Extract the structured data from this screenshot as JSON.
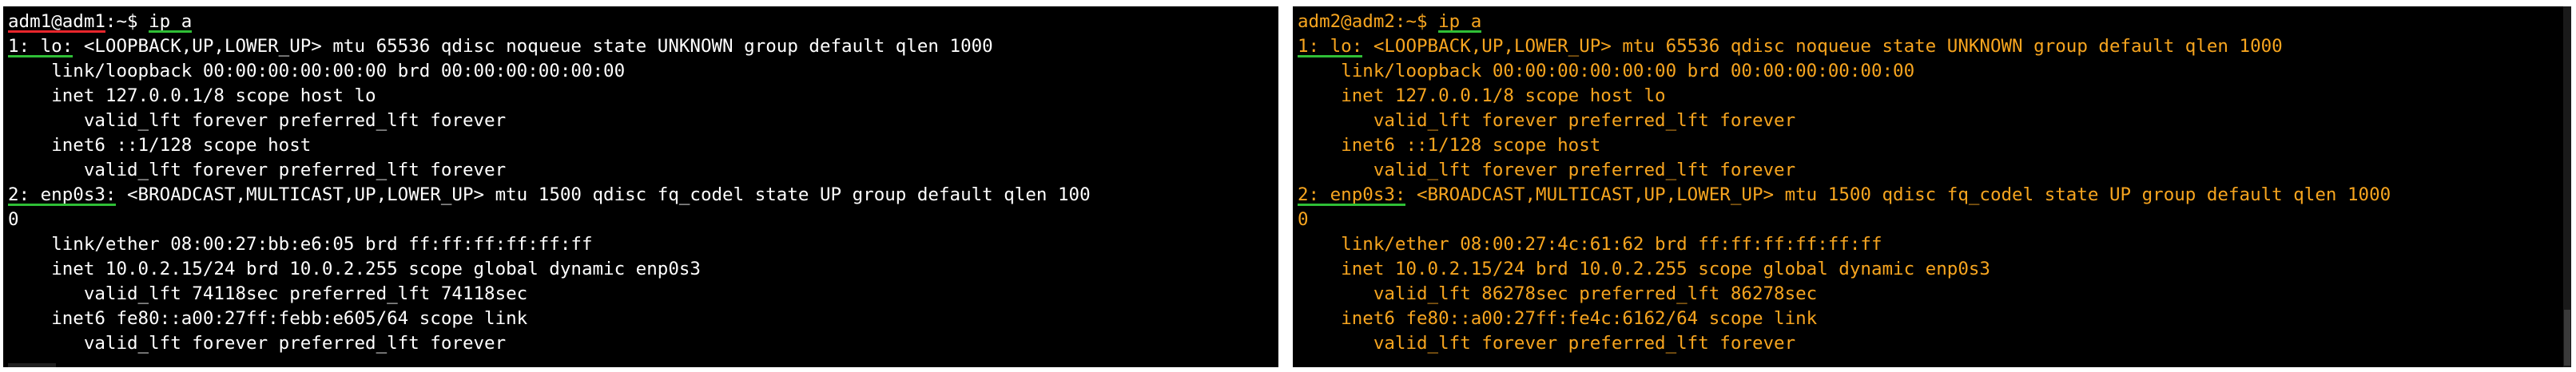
{
  "left_terminal": {
    "prompt_user": "adm1@adm1",
    "prompt_path": ":~$",
    "command": "ip a",
    "lines": [
      "link/loopback 00:00:00:00:00:00 brd 00:00:00:00:00:00",
      "inet 127.0.0.1/8 scope host lo",
      "valid_lft forever preferred_lft forever",
      "inet6 ::1/128 scope host",
      "valid_lft forever preferred_lft forever"
    ],
    "if1_label": "1: lo:",
    "if1_rest": " <LOOPBACK,UP,LOWER_UP> mtu 65536 qdisc noqueue state UNKNOWN group default qlen 1000",
    "if2_label": "2: enp0s3:",
    "if2_rest": " <BROADCAST,MULTICAST,UP,LOWER_UP> mtu 1500 qdisc fq_codel state UP group default qlen 100",
    "if2_wrap": "0",
    "if2_lines": [
      "link/ether 08:00:27:bb:e6:05 brd ff:ff:ff:ff:ff:ff",
      "inet 10.0.2.15/24 brd 10.0.2.255 scope global dynamic enp0s3",
      "valid_lft 74118sec preferred_lft 74118sec",
      "inet6 fe80::a00:27ff:febb:e605/64 scope link",
      "valid_lft forever preferred_lft forever"
    ]
  },
  "right_terminal": {
    "prompt_user": "adm2@adm2",
    "prompt_path": ":~$",
    "command": "ip a",
    "lines": [
      "link/loopback 00:00:00:00:00:00 brd 00:00:00:00:00:00",
      "inet 127.0.0.1/8 scope host lo",
      "valid_lft forever preferred_lft forever",
      "inet6 ::1/128 scope host",
      "valid_lft forever preferred_lft forever"
    ],
    "if1_label": "1: lo:",
    "if1_rest": " <LOOPBACK,UP,LOWER_UP> mtu 65536 qdisc noqueue state UNKNOWN group default qlen 1000",
    "if2_label": "2: enp0s3:",
    "if2_rest": " <BROADCAST,MULTICAST,UP,LOWER_UP> mtu 1500 qdisc fq_codel state UP group default qlen 1000",
    "if2_wrap": "0",
    "if2_lines": [
      "link/ether 08:00:27:4c:61:62 brd ff:ff:ff:ff:ff:ff",
      "inet 10.0.2.15/24 brd 10.0.2.255 scope global dynamic enp0s3",
      "valid_lft 86278sec preferred_lft 86278sec",
      "inet6 fe80::a00:27ff:fe4c:6162/64 scope link",
      "valid_lft forever preferred_lft forever"
    ]
  },
  "colors": {
    "left_text": "#ffffff",
    "right_text": "#f7a51f",
    "background": "#000000",
    "underline_red": "#e8262c",
    "underline_green": "#2fbf36"
  }
}
